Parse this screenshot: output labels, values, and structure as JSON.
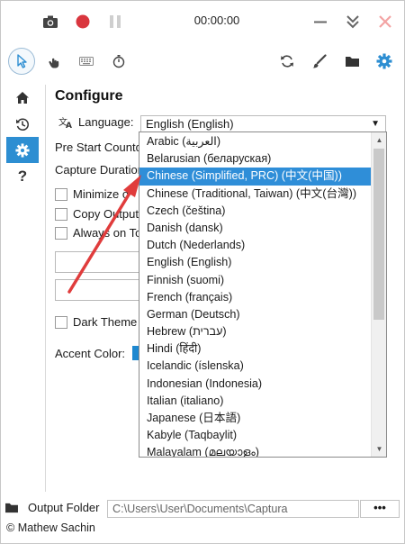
{
  "timer": "00:00:00",
  "configure": {
    "title": "Configure",
    "language_label": "Language:",
    "language_value": "English (English)",
    "rows": {
      "pre_start": "Pre Start Countd",
      "capture_duration": "Capture Duration",
      "minimize": "Minimize o",
      "copy_output": "Copy Output",
      "always_on_top": "Always on To",
      "dark_theme": "Dark Theme",
      "accent_color": "Accent Color:"
    },
    "accent_color_hex": "#1e88d0"
  },
  "dropdown": {
    "items": [
      "Arabic (العربية)",
      "Belarusian (беларуская)",
      "Chinese (Simplified, PRC) (中文(中国))",
      "Chinese (Traditional, Taiwan) (中文(台灣))",
      "Czech (čeština)",
      "Danish (dansk)",
      "Dutch (Nederlands)",
      "English (English)",
      "Finnish (suomi)",
      "French (français)",
      "German (Deutsch)",
      "Hebrew (עברית)",
      "Hindi (हिंदी)",
      "Icelandic (íslenska)",
      "Indonesian (Indonesia)",
      "Italian (italiano)",
      "Japanese (日本語)",
      "Kabyle (Taqbaylit)",
      "Malayalam (മലയാളം)"
    ],
    "selected_index": 2
  },
  "footer": {
    "output_folder_label": "Output Folder",
    "output_path": "C:\\Users\\User\\Documents\\Captura",
    "more_label": "•••",
    "credit": "© Mathew Sachin"
  },
  "colors": {
    "accent": "#2d8ed2",
    "record": "#d9363e",
    "close": "#f3a3a3",
    "annotation_arrow": "#e03c3c"
  },
  "icons": {
    "top": [
      "camera-icon",
      "record-icon",
      "pause-icon",
      "minimize-icon",
      "collapse-icon",
      "close-icon"
    ],
    "tools": [
      "cursor-icon",
      "hand-click-icon",
      "keyboard-icon",
      "stopwatch-icon",
      "refresh-icon",
      "brush-icon",
      "folder-icon",
      "settings-icon"
    ],
    "nav": [
      "home-icon",
      "history-icon",
      "settings-icon",
      "help-icon"
    ]
  }
}
